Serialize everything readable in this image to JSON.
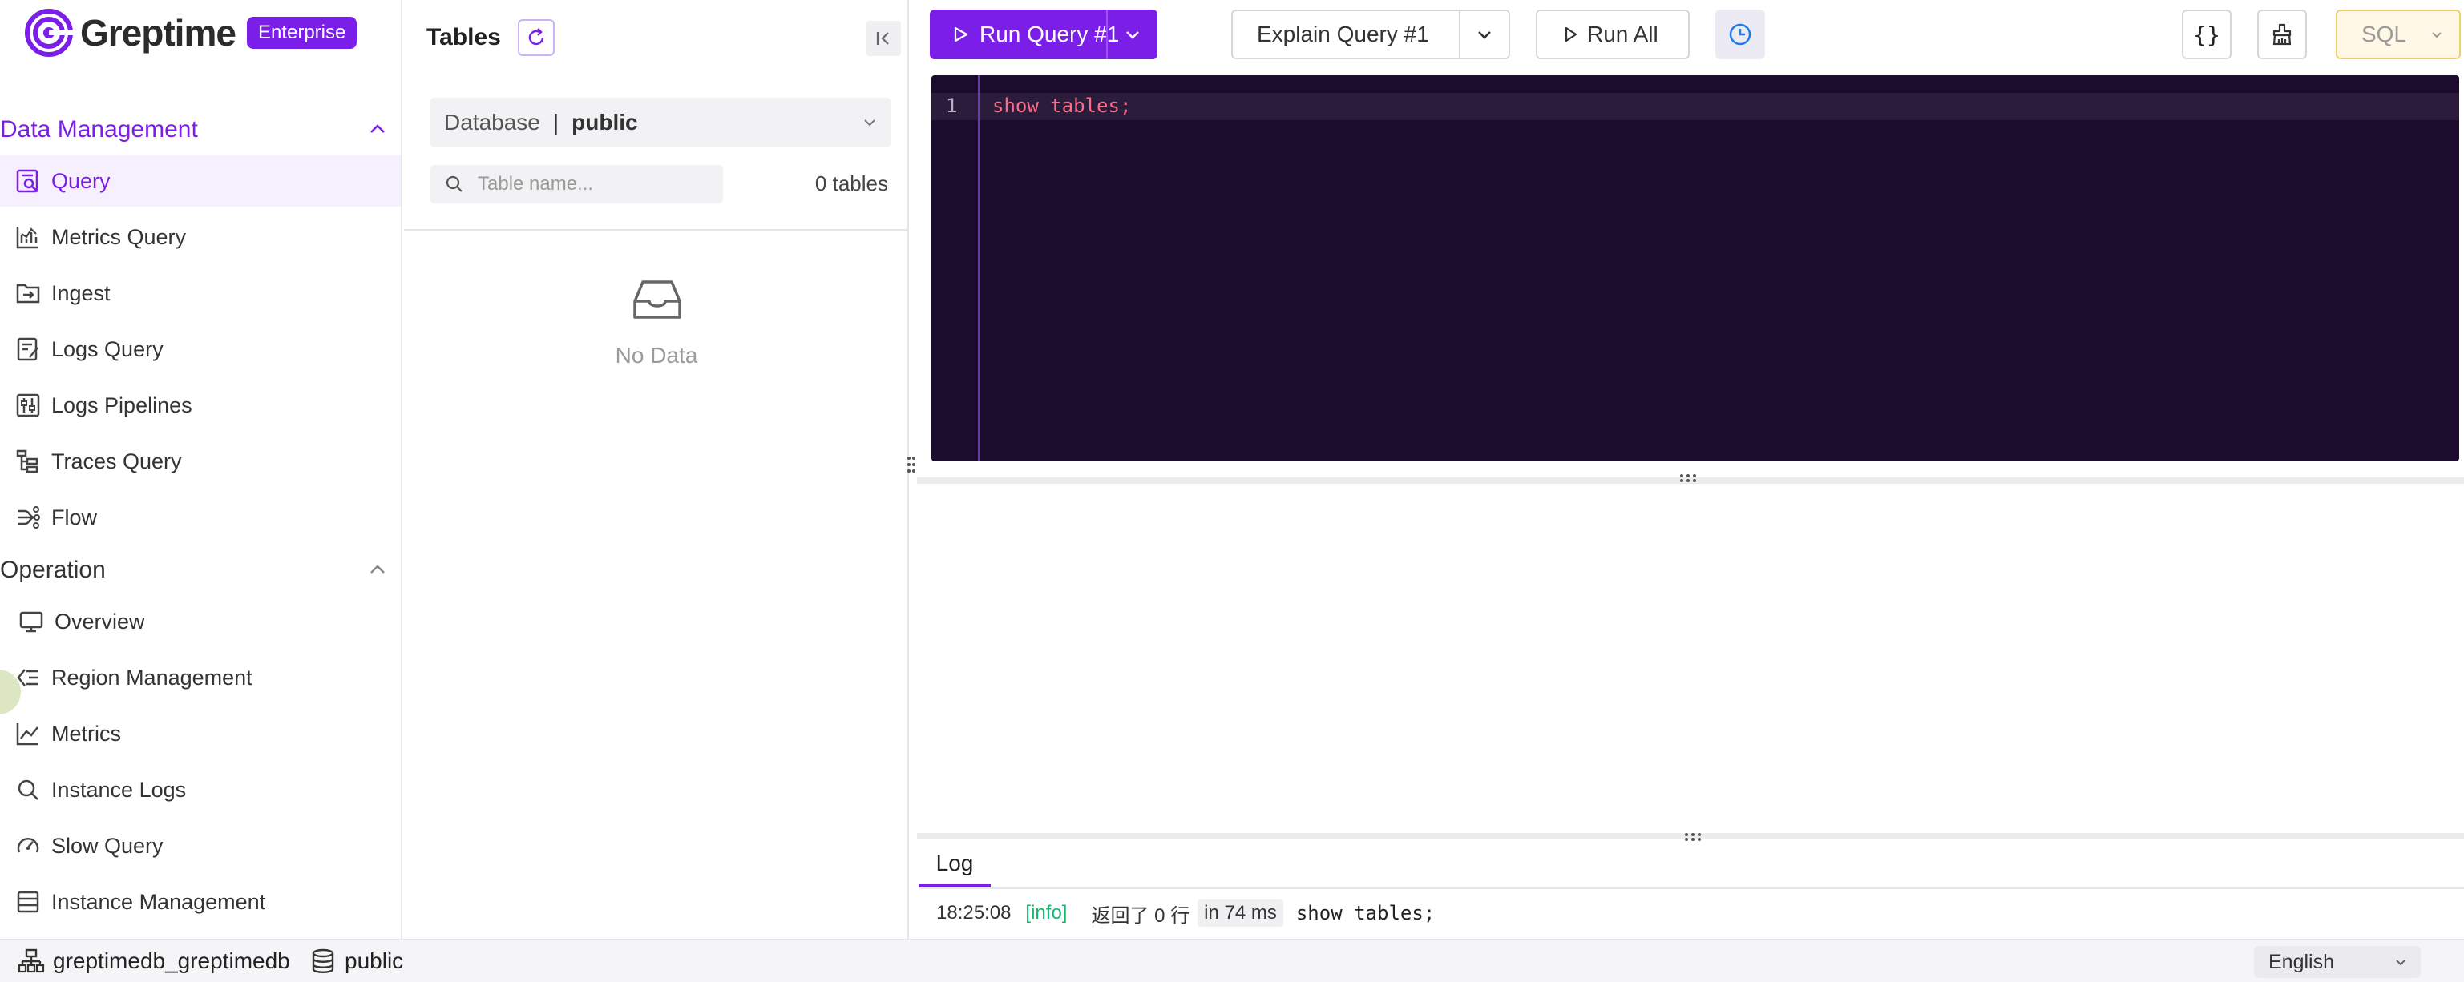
{
  "brand": {
    "name": "Greptime",
    "badge": "Enterprise"
  },
  "sidebar": {
    "data_management": {
      "title": "Data Management",
      "items": [
        {
          "label": "Query",
          "icon": "query-icon",
          "active": true
        },
        {
          "label": "Metrics Query",
          "icon": "metrics-chart-icon"
        },
        {
          "label": "Ingest",
          "icon": "ingest-icon"
        },
        {
          "label": "Logs Query",
          "icon": "logs-query-icon"
        },
        {
          "label": "Logs Pipelines",
          "icon": "pipeline-icon"
        },
        {
          "label": "Traces Query",
          "icon": "traces-icon"
        },
        {
          "label": "Flow",
          "icon": "flow-icon"
        }
      ]
    },
    "operation": {
      "title": "Operation",
      "items": [
        {
          "label": "Overview",
          "icon": "monitor-icon"
        },
        {
          "label": "Region Management",
          "icon": "region-icon"
        },
        {
          "label": "Metrics",
          "icon": "line-chart-icon"
        },
        {
          "label": "Instance Logs",
          "icon": "search-icon"
        },
        {
          "label": "Slow Query",
          "icon": "gauge-icon"
        },
        {
          "label": "Instance Management",
          "icon": "table-icon"
        }
      ]
    }
  },
  "tables_panel": {
    "title": "Tables",
    "database_label": "Database",
    "database_sep": "|",
    "database_value": "public",
    "search_placeholder": "Table name...",
    "count": "0 tables",
    "empty_text": "No Data"
  },
  "toolbar": {
    "run_label": "Run Query #1",
    "explain_label": "Explain Query #1",
    "run_all_label": "Run All",
    "format_label": "{}",
    "language": "SQL"
  },
  "editor": {
    "line_number": "1",
    "code": "show tables;"
  },
  "log": {
    "tab_label": "Log",
    "entry": {
      "time": "18:25:08",
      "level": "[info]",
      "message": "返回了 0 行",
      "duration": "in 74 ms",
      "sql": "show tables;"
    }
  },
  "statusbar": {
    "instance": "greptimedb_greptimedb",
    "database": "public",
    "ui_language": "English"
  },
  "colors": {
    "accent": "#7b1fe8",
    "editor_bg": "#1b0b2c",
    "code_text": "#ff6b8a",
    "info_text": "#14b870",
    "lang_select_bg": "#fff8e6"
  }
}
